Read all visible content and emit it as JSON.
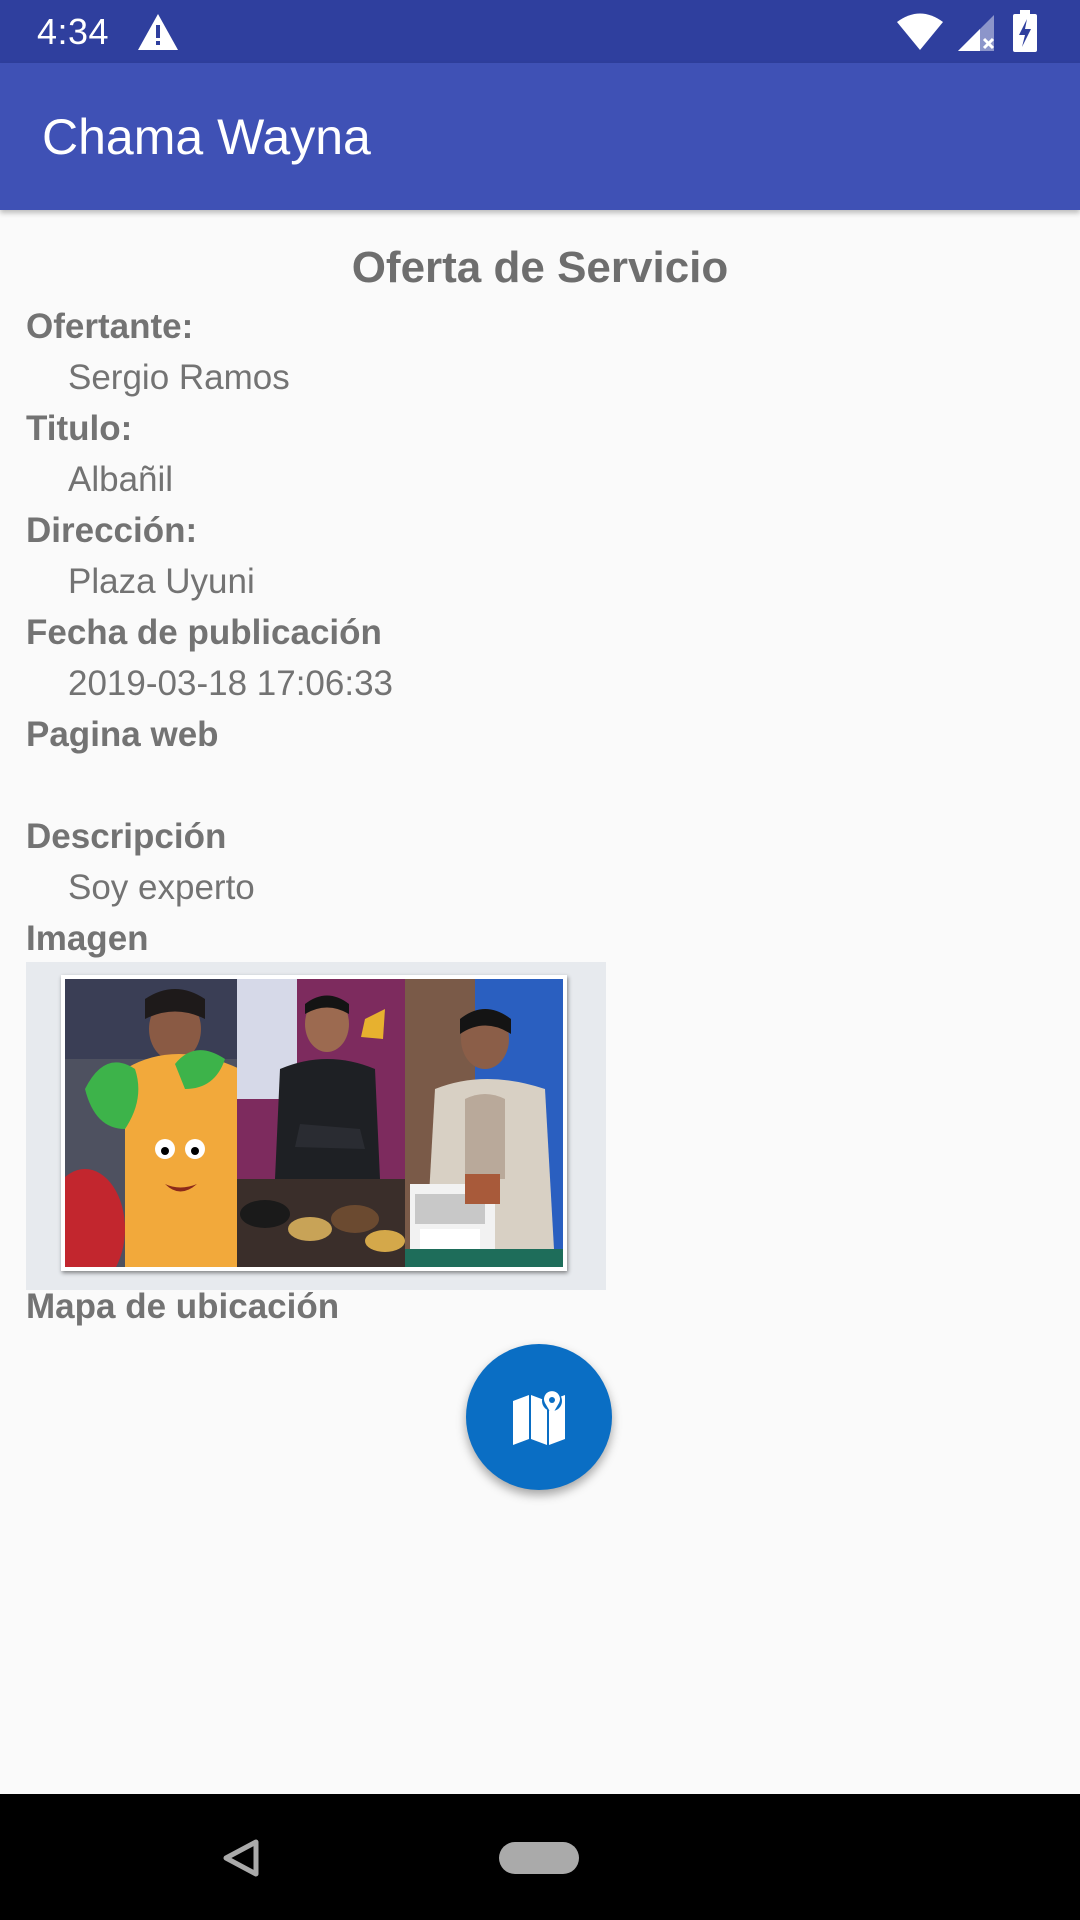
{
  "status_bar": {
    "time": "4:34",
    "icons": [
      "warning-icon",
      "wifi-icon",
      "signal-icon",
      "battery-icon"
    ]
  },
  "app_bar": {
    "title": "Chama Wayna"
  },
  "page": {
    "heading": "Oferta de Servicio",
    "fields": [
      {
        "label": "Ofertante:",
        "value": "Sergio Ramos"
      },
      {
        "label": "Titulo:",
        "value": "Albañil"
      },
      {
        "label": "Dirección:",
        "value": "Plaza Uyuni"
      },
      {
        "label": "Fecha de publicación",
        "value": "2019-03-18 17:06:33"
      },
      {
        "label": "Pagina web",
        "value": ""
      },
      {
        "label": "Descripción",
        "value": "Soy experto"
      }
    ],
    "image_label": "Imagen",
    "map_label": "Mapa de ubicación"
  },
  "fab": {
    "icon": "map-icon"
  },
  "nav_bar": {
    "icons": [
      "back-icon",
      "home-icon"
    ]
  },
  "colors": {
    "status_bar": "#2F3F9E",
    "app_bar": "#3F51B5",
    "fab": "#0A6EC4",
    "text": "#737373",
    "background": "#FAFAFA"
  }
}
